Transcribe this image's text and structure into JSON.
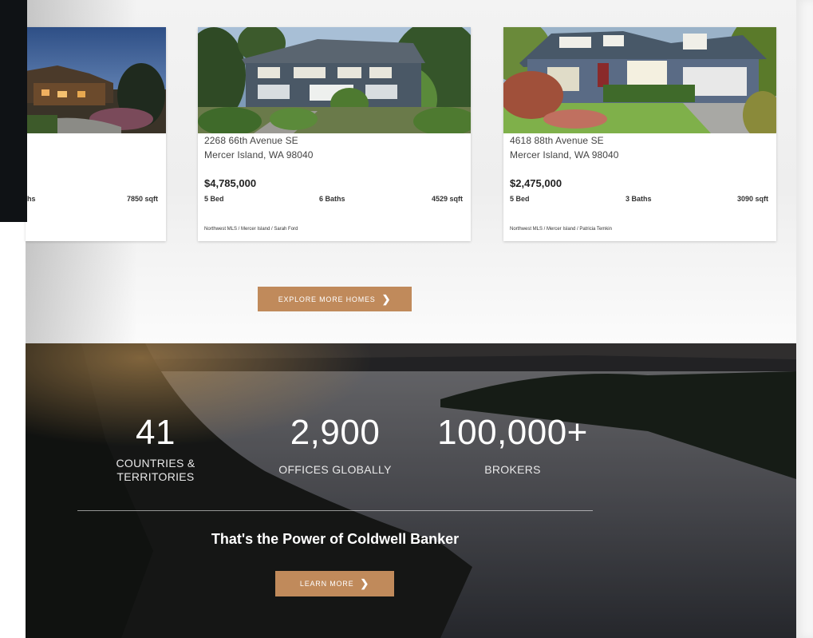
{
  "listings": [
    {
      "address_line1": "",
      "address_line2": "",
      "price": "",
      "beds": "",
      "baths": "aths",
      "sqft": "7850 sqft",
      "mls": ""
    },
    {
      "address_line1": "2268 66th Avenue SE",
      "address_line2": "Mercer Island, WA 98040",
      "price": "$4,785,000",
      "beds": "5 Bed",
      "baths": "6 Baths",
      "sqft": "4529 sqft",
      "mls": "Northwest MLS / Mercer Island / Sarah Ford"
    },
    {
      "address_line1": "4618 88th Avenue SE",
      "address_line2": "Mercer Island, WA 98040",
      "price": "$2,475,000",
      "beds": "5 Bed",
      "baths": "3 Baths",
      "sqft": "3090 sqft",
      "mls": "Northwest MLS / Mercer Island / Patricia Temkin"
    }
  ],
  "explore_button": {
    "label": "EXPLORE MORE HOMES",
    "icon": "chevron-right-icon"
  },
  "stats": [
    {
      "number": "41",
      "label": "COUNTRIES & TERRITORIES"
    },
    {
      "number": "2,900",
      "label": "OFFICES GLOBALLY"
    },
    {
      "number": "100,000+",
      "label": "BROKERS"
    }
  ],
  "tagline": "That's the Power of Coldwell Banker",
  "learn_button": {
    "label": "LEARN MORE",
    "icon": "chevron-right-icon"
  },
  "colors": {
    "accent": "#c08a5b",
    "dark_panel": "#0f1215"
  }
}
